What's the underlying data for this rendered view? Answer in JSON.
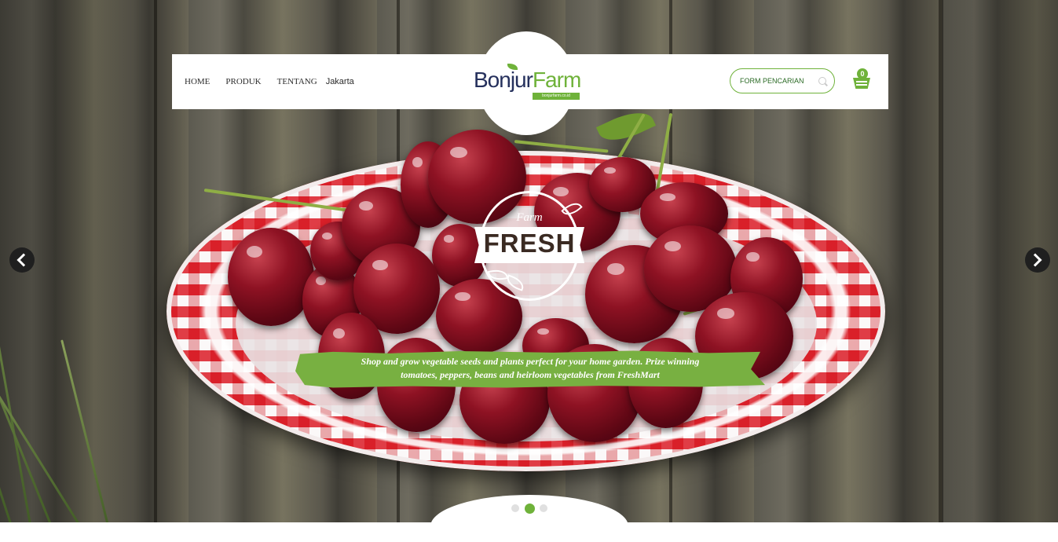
{
  "nav": {
    "items": [
      "HOME",
      "PRODUK",
      "TENTANG"
    ],
    "location": "Jakarta"
  },
  "logo": {
    "name_part1": "Bonjur",
    "name_part2": "Farm",
    "subtitle": "bonjurfarm.co.id"
  },
  "search": {
    "placeholder": "FORM PENCARIAN",
    "icon": "search-icon"
  },
  "cart": {
    "count": "0",
    "icon": "basket-icon"
  },
  "slider": {
    "badge_script": "Farm",
    "badge_main": "FRESH",
    "tagline": "Shop and grow vegetable seeds and plants perfect for your home garden. Prize winning tomatoes, peppers, beans and heirloom vegetables from FreshMart",
    "prev_icon": "chevron-left-icon",
    "next_icon": "chevron-right-icon",
    "slide_count": 3,
    "active_slide": 2
  },
  "colors": {
    "brand_green": "#6fb23a",
    "brand_navy": "#25305c",
    "header_bg": "#ffffff"
  }
}
